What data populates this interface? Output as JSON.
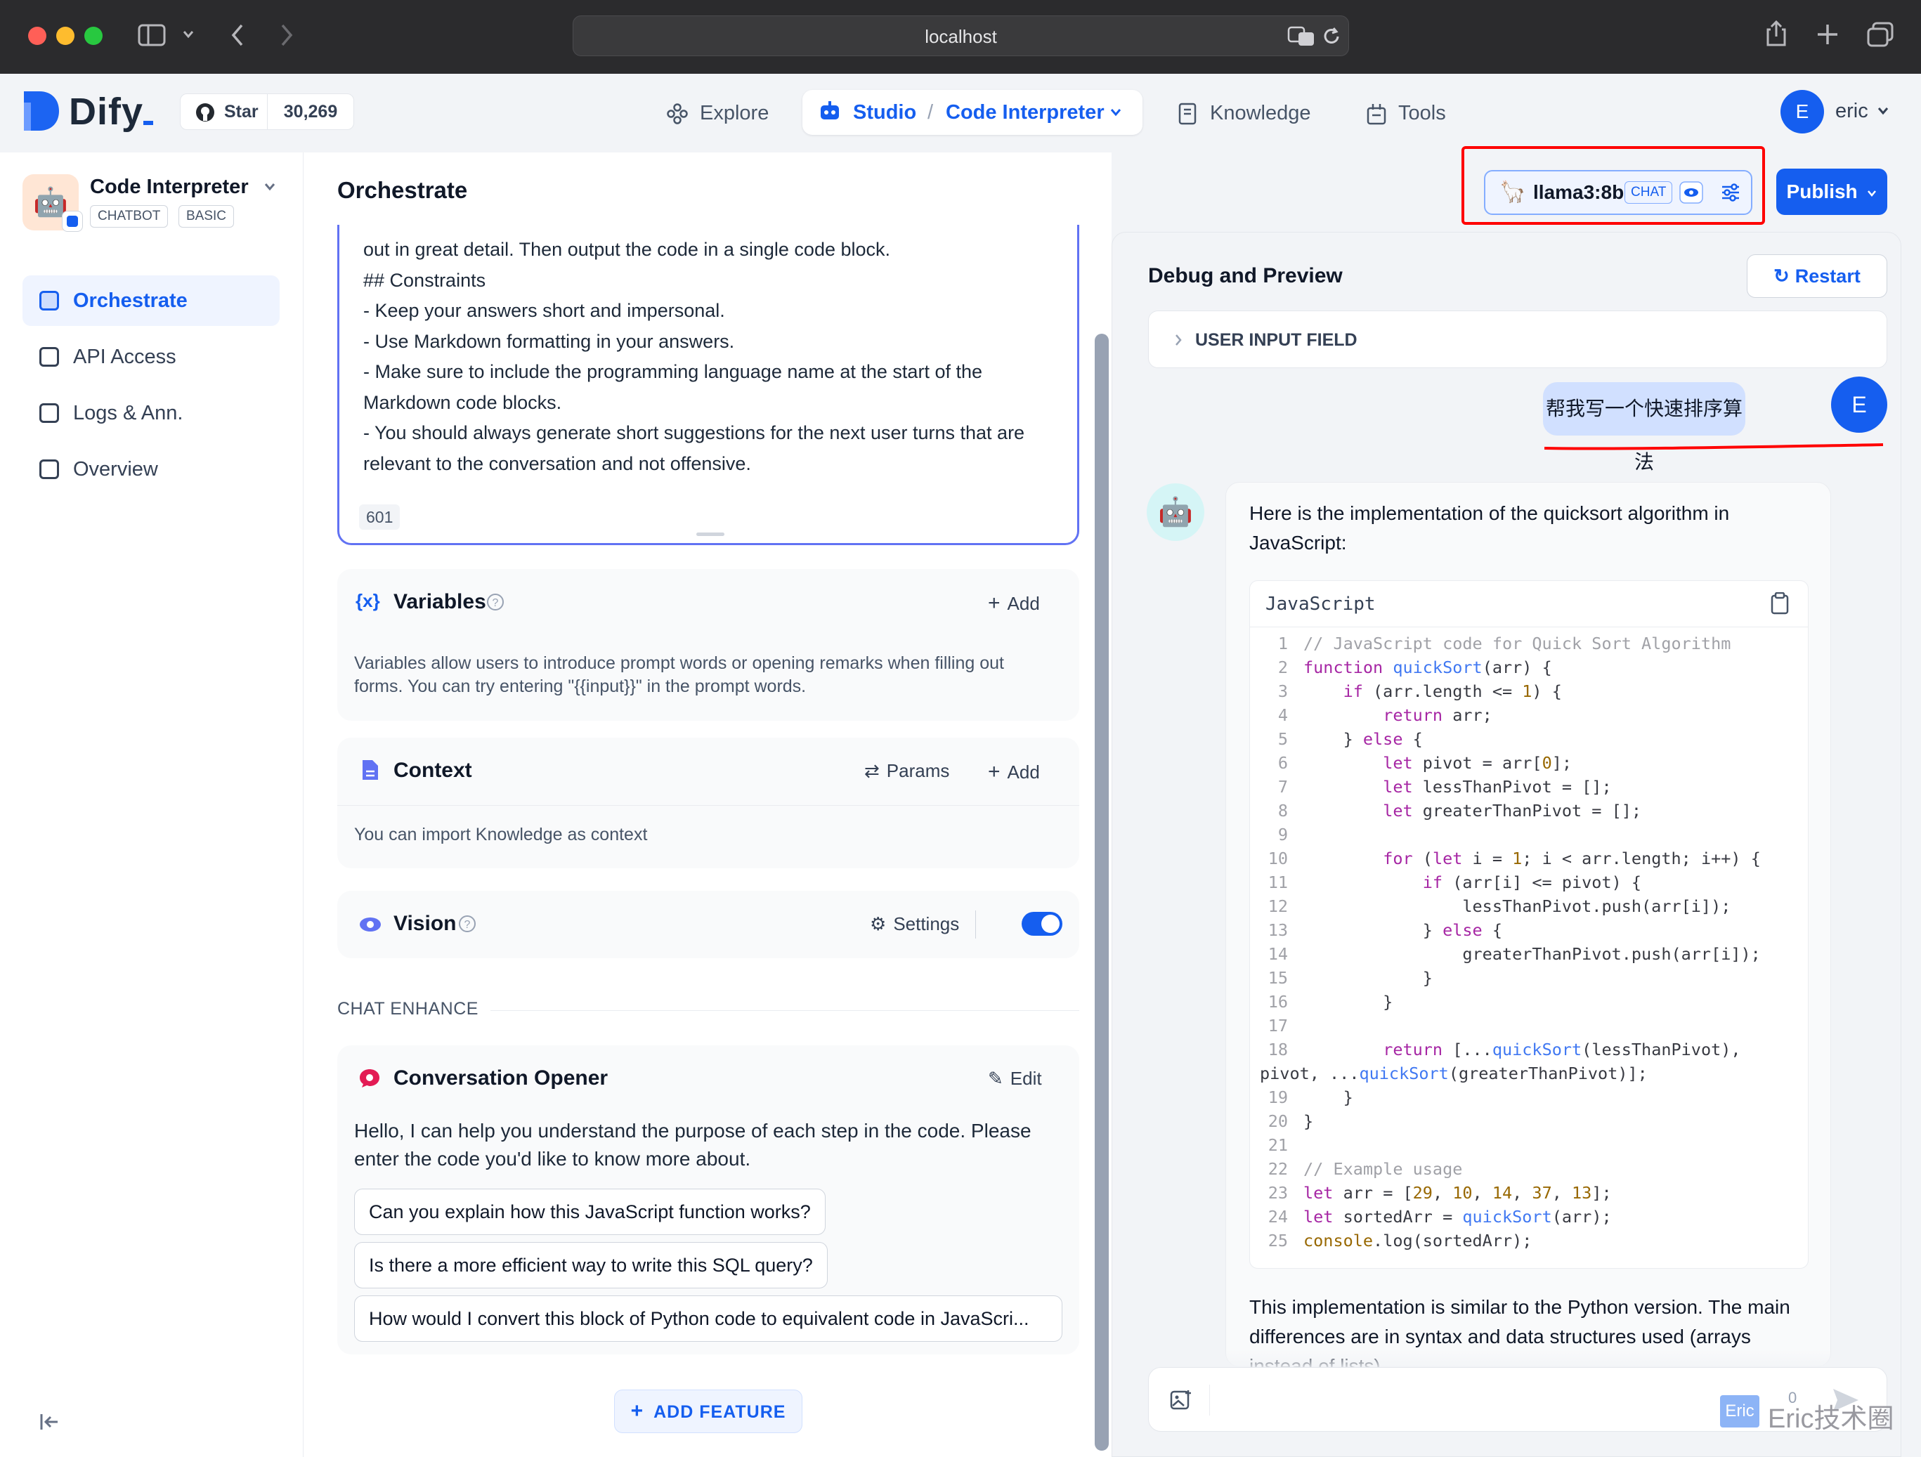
{
  "browser": {
    "url": "localhost"
  },
  "header": {
    "logo": "Dify",
    "star_label": "Star",
    "star_count": "30,269",
    "nav": {
      "explore": "Explore",
      "studio": "Studio",
      "studio_separator": "/",
      "current_app": "Code Interpreter",
      "knowledge": "Knowledge",
      "tools": "Tools"
    },
    "user": {
      "initial": "E",
      "name": "eric"
    }
  },
  "sidebar": {
    "app_name": "Code Interpreter",
    "badges": [
      "CHATBOT",
      "BASIC"
    ],
    "items": [
      {
        "label": "Orchestrate",
        "active": true
      },
      {
        "label": "API Access"
      },
      {
        "label": "Logs & Ann."
      },
      {
        "label": "Overview"
      }
    ]
  },
  "orchestrate": {
    "title": "Orchestrate",
    "model": {
      "name": "llama3:8b",
      "mode": "CHAT"
    },
    "publish_label": "Publish",
    "prompt_lines": [
      "out in great detail. Then output the code in a single code block.",
      "## Constraints",
      "- Keep your answers short and impersonal.",
      "- Use Markdown formatting in your answers.",
      "- Make sure to include the programming language name at the start of the",
      "Markdown code blocks.",
      "- You should always generate short suggestions for the next user turns that are",
      "relevant to the conversation and not offensive."
    ],
    "prompt_char_count": "601",
    "variables": {
      "title": "Variables",
      "add_label": "Add",
      "description": "Variables allow users to introduce prompt words or opening remarks when filling out forms. You can try entering \"{{input}}\" in the prompt words."
    },
    "context": {
      "title": "Context",
      "params_label": "Params",
      "add_label": "Add",
      "description": "You can import Knowledge as context"
    },
    "vision": {
      "title": "Vision",
      "settings_label": "Settings",
      "enabled": true
    },
    "chat_enhance_label": "CHAT ENHANCE",
    "opener": {
      "title": "Conversation Opener",
      "edit_label": "Edit",
      "text": "Hello, I can help you understand the purpose of each step in the code. Please enter the code you'd like to know more about.",
      "questions": [
        "Can you explain how this JavaScript function works?",
        "Is there a more efficient way to write this SQL query?",
        "How would I convert this block of Python code to equivalent code in JavaScri..."
      ]
    },
    "add_feature_label": "ADD FEATURE"
  },
  "debug": {
    "title": "Debug and Preview",
    "restart_label": "Restart",
    "user_input_field_label": "USER INPUT FIELD",
    "user_message": "帮我写一个快速排序算法",
    "bot_intro": "Here is the implementation of the quicksort algorithm in JavaScript:",
    "code_language": "JavaScript",
    "code_lines": [
      "// JavaScript code for Quick Sort Algorithm",
      "function quickSort(arr) {",
      "    if (arr.length <= 1) {",
      "        return arr;",
      "    } else {",
      "        let pivot = arr[0];",
      "        let lessThanPivot = [];",
      "        let greaterThanPivot = [];",
      "",
      "        for (let i = 1; i < arr.length; i++) {",
      "            if (arr[i] <= pivot) {",
      "                lessThanPivot.push(arr[i]);",
      "            } else {",
      "                greaterThanPivot.push(arr[i]);",
      "            }",
      "        }",
      "",
      "        return [...quickSort(lessThanPivot),",
      "pivot, ...quickSort(greaterThanPivot)];",
      "    }",
      "}",
      "",
      "// Example usage",
      "let arr = [29, 10, 14, 37, 13];",
      "let sortedArr = quickSort(arr);",
      "console.log(sortedArr);"
    ],
    "line_numbers": [
      "1",
      "2",
      "3",
      "4",
      "5",
      "6",
      "7",
      "8",
      "9",
      "10",
      "11",
      "12",
      "13",
      "14",
      "15",
      "16",
      "17",
      "18",
      "",
      "19",
      "20",
      "21",
      "22",
      "23",
      "24",
      "25"
    ],
    "bot_outro": "This implementation is similar to the Python version. The main differences are in syntax and data structures used (arrays instead of lists).",
    "input_counter": "0"
  },
  "watermark": {
    "badge": "Eric",
    "text": "Eric技术圈"
  },
  "colors": {
    "primary": "#155eef",
    "highlight": "#ff0000"
  }
}
